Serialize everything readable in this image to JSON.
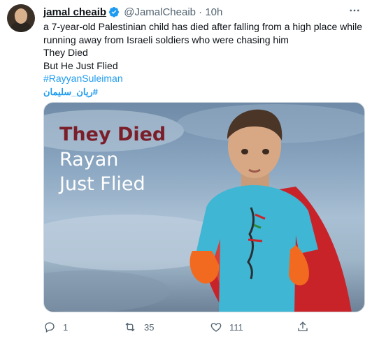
{
  "tweet": {
    "name": "jamal cheaib",
    "handle": "@JamalCheaib",
    "separator": "·",
    "time": "10h",
    "text_line1": "a 7-year-old Palestinian child has died after falling from a high place while running away from Israeli soldiers who were chasing him",
    "text_line2": "They Died",
    "text_line3": "But He Just Flied",
    "hashtag1": "#RayyanSuleiman",
    "hashtag2": "#ريان_سليمان",
    "media": {
      "line1": "They Died",
      "line2": "Rayan",
      "line3": "Just Flied"
    },
    "actions": {
      "reply_count": "1",
      "retweet_count": "35",
      "like_count": "111"
    }
  },
  "icons": {
    "verified": "verified-badge-icon",
    "more": "more-options-icon",
    "reply": "reply-icon",
    "retweet": "retweet-icon",
    "like": "heart-icon",
    "share": "share-icon"
  },
  "colors": {
    "link": "#1d9bf0",
    "muted": "#536471",
    "text": "#0f1419",
    "media_title": "#7a1f2a"
  }
}
